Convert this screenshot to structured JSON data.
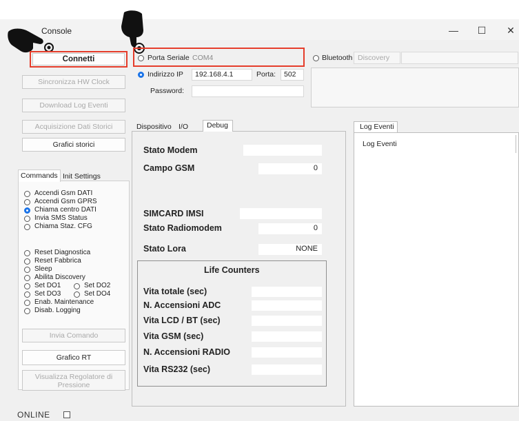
{
  "window": {
    "title": "Console",
    "controls": {
      "minimize": "—",
      "maximize": "☐",
      "close": "✕"
    }
  },
  "left": {
    "connect_label": "Connetti",
    "buttons": [
      "Sincronizza HW Clock",
      "Download Log Eventi",
      "Acquisizione Dati Storici",
      "Grafici storici"
    ],
    "tabs": [
      "Commands",
      "Init Settings"
    ],
    "commands_group1": [
      "Accendi Gsm DATI",
      "Accendi Gsm GPRS",
      "Chiama centro DATI",
      "Invia SMS Status",
      "Chiama Staz. CFG"
    ],
    "commands_group2": [
      "Reset Diagnostica",
      "Reset Fabbrica",
      "Sleep",
      "Abilita Discovery"
    ],
    "set_do": [
      "Set DO1",
      "Set DO2",
      "Set DO3",
      "Set DO4"
    ],
    "commands_group3": [
      "Enab. Maintenance",
      "Disab. Logging"
    ],
    "send_label": "Invia Comando",
    "grafico_rt": "Grafico RT",
    "regolatore": "Visualizza Regolatore di Pressione"
  },
  "connection": {
    "serial_label": "Porta Seriale",
    "serial_value": "COM4",
    "bluetooth_label": "Bluetooth",
    "discovery_label": "Discovery",
    "ip_label": "Indirizzo IP",
    "ip_value": "192.168.4.1",
    "port_label": "Porta:",
    "port_value": "502",
    "password_label": "Password:"
  },
  "center": {
    "tabs": [
      "Dispositivo",
      "I/O",
      "Debug"
    ],
    "stato_modem": "Stato Modem",
    "campo_gsm": "Campo GSM",
    "campo_gsm_value": "0",
    "simcard": "SIMCARD IMSI",
    "stato_radiomodem": "Stato Radiomodem",
    "stato_radiomodem_value": "0",
    "stato_lora": "Stato Lora",
    "stato_lora_value": "NONE",
    "life_title": "Life Counters",
    "life_rows": [
      "Vita totale (sec)",
      "N. Accensioni ADC",
      "Vita LCD / BT (sec)",
      "Vita GSM (sec)",
      "N. Accensioni RADIO",
      "Vita RS232 (sec)"
    ]
  },
  "log": {
    "tab": "Log Eventi",
    "header": "Log Eventi"
  },
  "status": {
    "online_label": "ONLINE"
  }
}
